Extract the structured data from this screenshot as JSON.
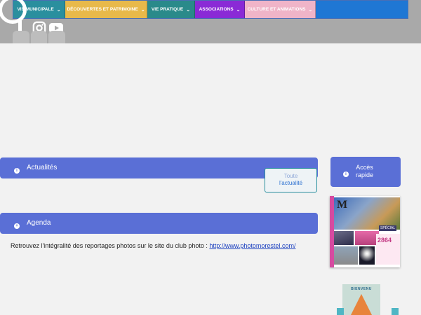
{
  "nav": {
    "items": [
      {
        "label": "Vie municipale",
        "color": "#2a8f9e"
      },
      {
        "label": "Découvertes et patrimoine",
        "color": "#e8b94a"
      },
      {
        "label": "Vie pratique",
        "color": "#2a8a8a"
      },
      {
        "label": "Associations",
        "color": "#8a2ad6"
      },
      {
        "label": "Culture et animations",
        "color": "#f0b4c8"
      }
    ],
    "chevron": "⌄",
    "fill_color": "#1f77d4"
  },
  "social": {
    "icons": [
      "instagram-icon",
      "youtube-icon"
    ]
  },
  "actualites": {
    "label": "Actualités",
    "icon": "i"
  },
  "toute_actualite": {
    "line1": "Toute",
    "line2": "l'actualité"
  },
  "agenda": {
    "label": "Agenda",
    "icon": "+"
  },
  "photo_text": {
    "text": "Retrouvez l'intégralité des reportages photos sur le site du club photo : ",
    "link": "http://www.photomorestel.com/"
  },
  "acces": {
    "line1": "Accès",
    "line2": "rapide",
    "icon": "i"
  },
  "magazine": {
    "letter": "M",
    "number": "2864",
    "tag": "SPÉCIAL"
  },
  "camping": {
    "label": "BIENVENU"
  },
  "colors": {
    "accent": "#5a6fd6",
    "header": "#a9a9a9",
    "background": "#f2f2f2"
  }
}
